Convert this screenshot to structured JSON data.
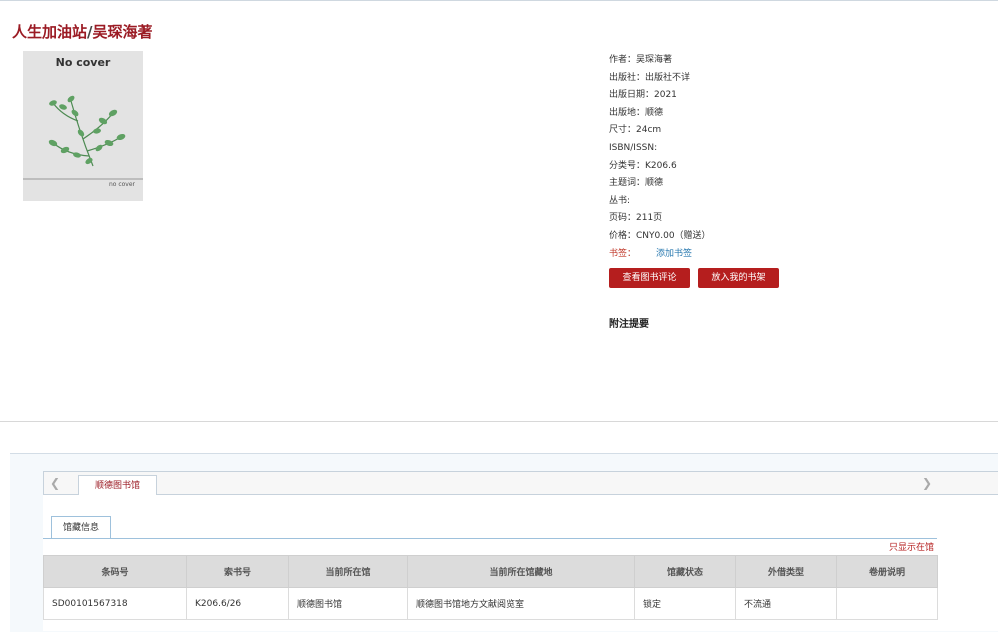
{
  "book": {
    "title_main": "人生加油站",
    "title_sep": "/",
    "title_author": "吴琛海著",
    "cover": {
      "text_top": "No cover",
      "text_bottom": "no cover"
    }
  },
  "meta": {
    "author": "作者：吴琛海著",
    "publisher": "出版社：出版社不详",
    "pub_date": "出版日期：2021",
    "pub_place": "出版地：顺德",
    "size": "尺寸：24cm",
    "isbn": "ISBN/ISSN:",
    "classno": "分类号：K206.6",
    "subject": "主题词：顺德",
    "series": "丛书:",
    "pages": "页码：211页",
    "price": "价格：CNY0.00（赠送）",
    "tags_label": "书签：",
    "add_tag": "添加书签"
  },
  "actions": {
    "view_reviews": "查看图书评论",
    "add_shelf": "放入我的书架"
  },
  "notes_heading": "附注提要",
  "holdings": {
    "library_tab": "顺德图书馆",
    "subtab": "馆藏信息",
    "only_this_lib": "只显示在馆",
    "columns": [
      "条码号",
      "索书号",
      "当前所在馆",
      "当前所在馆藏地",
      "馆藏状态",
      "外借类型",
      "卷册说明"
    ],
    "rows": [
      [
        "SD00101567318",
        "K206.6/26",
        "顺德图书馆",
        "顺德图书馆地方文献阅览室",
        "锁定",
        "不流通",
        ""
      ]
    ]
  },
  "icons": {
    "arrow_left": "chevron-left-icon",
    "arrow_right": "chevron-right-icon"
  },
  "colors": {
    "title_red": "#9b1b24",
    "button_red": "#b51e1e",
    "link_blue": "#2a7ab0",
    "leaf_green": "#5fa163"
  }
}
